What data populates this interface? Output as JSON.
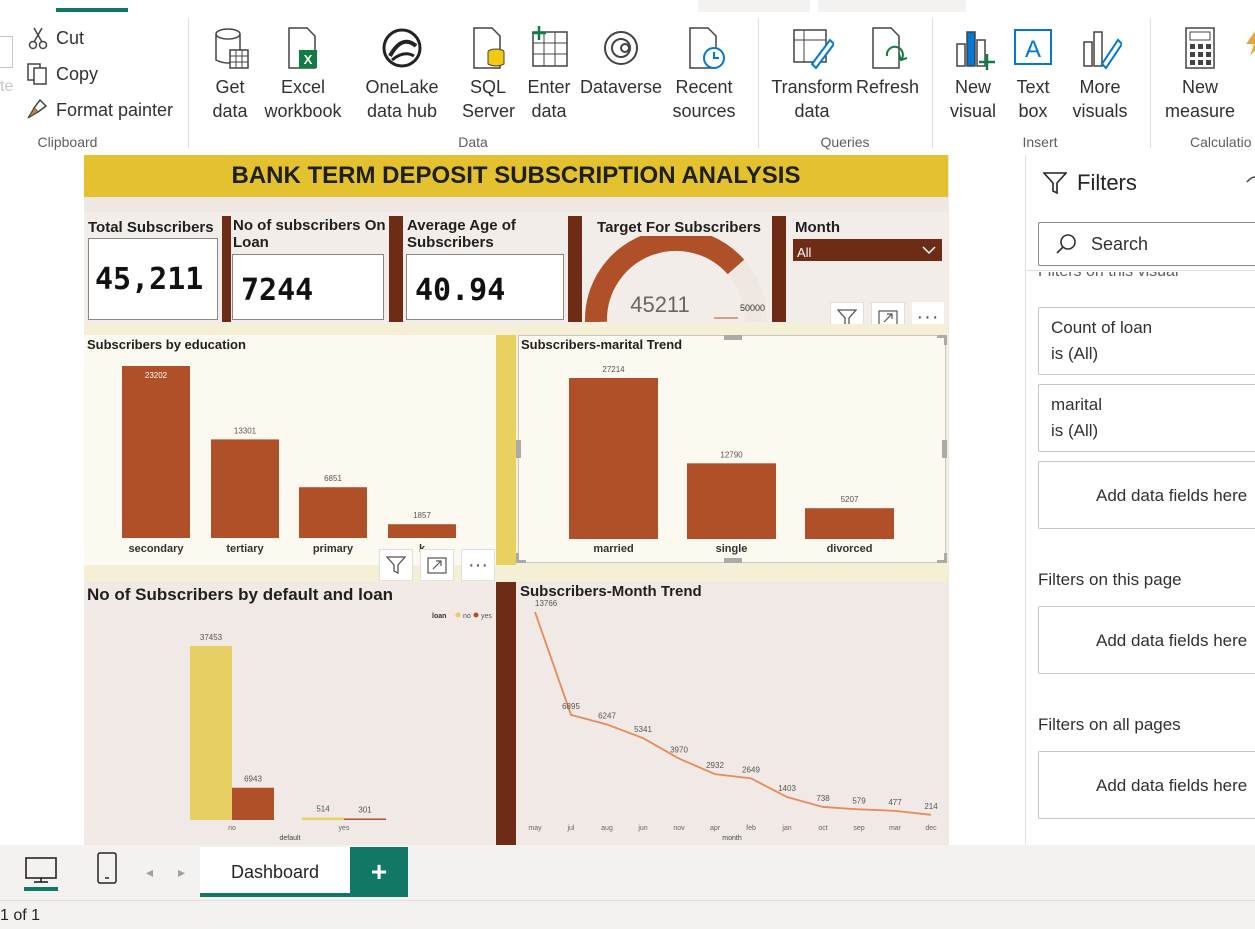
{
  "ribbon": {
    "clipboard": {
      "cut": "Cut",
      "copy": "Copy",
      "format_painter": "Format painter",
      "group": "Clipboard"
    },
    "data": {
      "get_data": "Get data",
      "excel": "Excel workbook",
      "onelake": "OneLake data hub",
      "sql": "SQL Server",
      "enter_data": "Enter data",
      "dataverse": "Dataverse",
      "recent": "Recent sources",
      "group": "Data"
    },
    "queries": {
      "transform": "Transform data",
      "refresh": "Refresh",
      "group": "Queries"
    },
    "insert": {
      "new_visual": "New visual",
      "text_box": "Text box",
      "more_visuals": "More visuals",
      "group": "Insert"
    },
    "calculations": {
      "new_measure": "New measure",
      "group": "Calculatio"
    }
  },
  "dashboard": {
    "title": "BANK TERM DEPOSIT SUBSCRIPTION ANALYSIS",
    "kpis": {
      "total_label": "Total Subscribers",
      "total_value": "45,211",
      "loan_label": "No of subscribers On Loan",
      "loan_value": "7244",
      "age_label": "Average Age of Subscribers",
      "age_value": "40.94",
      "target_label": "Target For Subscribers",
      "target_value": "45211",
      "target_max": "50000",
      "month_label": "Month",
      "month_value": "All"
    }
  },
  "chart_data": [
    {
      "type": "bar",
      "title": "Subscribers by education",
      "categories": [
        "secondary",
        "tertiary",
        "primary",
        "unknown"
      ],
      "values": [
        23202,
        13301,
        6851,
        1857
      ],
      "visible_categories": [
        "secondary",
        "tertiary",
        "primary",
        "k"
      ]
    },
    {
      "type": "bar",
      "title": "Subscribers-marital Trend",
      "categories": [
        "married",
        "single",
        "divorced"
      ],
      "values": [
        27214,
        12790,
        5207
      ]
    },
    {
      "type": "bar",
      "title": "No of Subscribers by default and loan",
      "xlabel": "default",
      "categories": [
        "no",
        "yes"
      ],
      "legend_title": "loan",
      "series": [
        {
          "name": "no",
          "values": [
            37453,
            514
          ],
          "color": "#e6cf63"
        },
        {
          "name": "yes",
          "values": [
            6943,
            301
          ],
          "color": "#b05028"
        }
      ]
    },
    {
      "type": "line",
      "title": "Subscribers-Month Trend",
      "xlabel": "month",
      "categories": [
        "may",
        "jul",
        "aug",
        "jun",
        "nov",
        "apr",
        "feb",
        "jan",
        "oct",
        "sep",
        "mar",
        "dec"
      ],
      "values": [
        13766,
        6895,
        6247,
        5341,
        3970,
        2932,
        2649,
        1403,
        738,
        579,
        477,
        214
      ],
      "color": "#e88a5a"
    }
  ],
  "filters": {
    "title": "Filters",
    "search_placeholder": "Search",
    "visual_header": "Filters on this visual",
    "card1_field": "Count of loan",
    "card1_state": "is (All)",
    "card2_field": "marital",
    "card2_state": "is (All)",
    "add_fields": "Add data fields here",
    "page_header": "Filters on this page",
    "all_header": "Filters on all pages"
  },
  "bottom": {
    "page_tab": "Dashboard",
    "add_page": "+",
    "status": "1 of 1"
  },
  "colors": {
    "brand_green": "#117865",
    "bar_brown": "#b05028",
    "title_gold": "#e3c12f",
    "divider_brown": "#6e2c17"
  }
}
